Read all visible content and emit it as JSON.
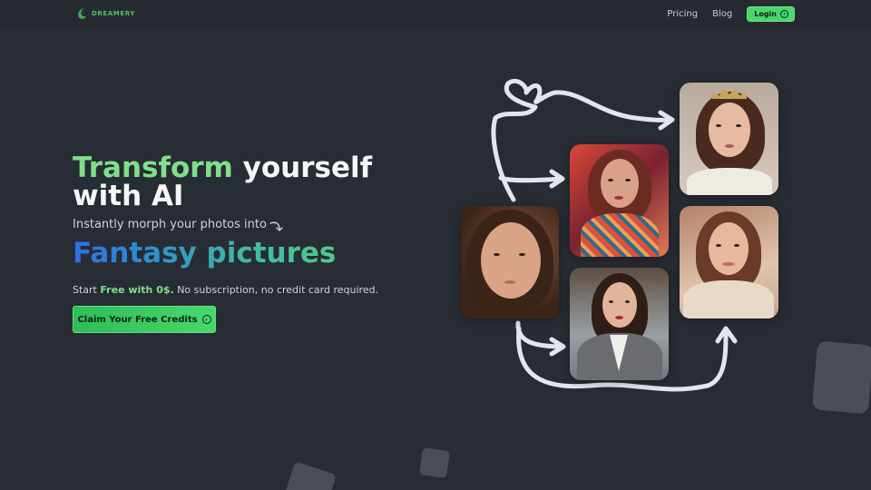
{
  "brand": {
    "name": "DREAMERY",
    "accent_color": "#4cc26a",
    "logo_icon": "crescent-leaf-icon"
  },
  "nav": {
    "links": [
      {
        "label": "Pricing"
      },
      {
        "label": "Blog"
      }
    ],
    "login_label": "Login",
    "login_icon": "arrow-right-circle-icon"
  },
  "hero": {
    "title_accent": "Transform",
    "title_rest_1": "yourself",
    "title_line_2": "with AI",
    "subtitle": "Instantly morph your photos into",
    "subtitle_icon": "curved-arrow-down-icon",
    "highlight": "Fantasy pictures",
    "free_prefix": "Start ",
    "free_bold": "Free with 0$.",
    "free_suffix": " No subscription, no credit card required.",
    "cta_label": "Claim Your Free Credits",
    "cta_icon": "arrow-right-circle-icon"
  },
  "gallery": {
    "items": [
      {
        "name": "original-portrait"
      },
      {
        "name": "fantasy-floral-portrait"
      },
      {
        "name": "crowned-princess-portrait"
      },
      {
        "name": "business-suit-portrait"
      },
      {
        "name": "cozy-sweater-portrait"
      }
    ]
  },
  "colors": {
    "background": "#282c34",
    "primary_green": "#48d86a",
    "gradient_blue": "#2f6fe0",
    "gradient_green": "#52c98e"
  }
}
